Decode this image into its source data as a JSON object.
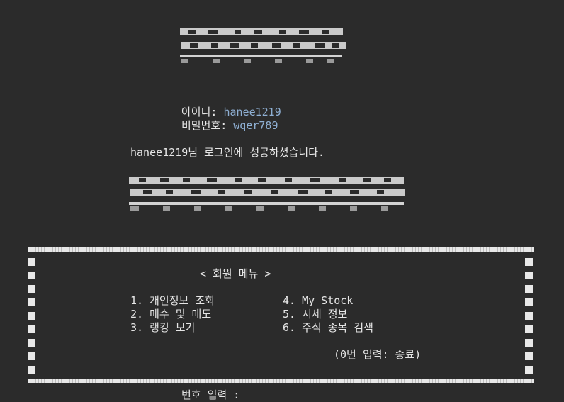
{
  "login": {
    "id_label": "아이디:",
    "id_value": "hanee1219",
    "pw_label": "비밀번호:",
    "pw_value": "wqer789",
    "success_message": "hanee1219님 로그인에 성공하셨습니다."
  },
  "menu": {
    "title": "< 회원 메뉴 >",
    "items": [
      "1. 개인정보 조회",
      "2. 매수 및 매도",
      "3. 랭킹 보기",
      "4. My Stock",
      "5. 시세 정보",
      "6. 주식 종목 검색"
    ],
    "exit_hint": "(0번 입력: 종료)"
  },
  "prompt": {
    "label": "번호 입력 :"
  },
  "colors": {
    "background": "#2b2b2b",
    "text": "#e6e6e6",
    "value": "#8fb0d4"
  }
}
